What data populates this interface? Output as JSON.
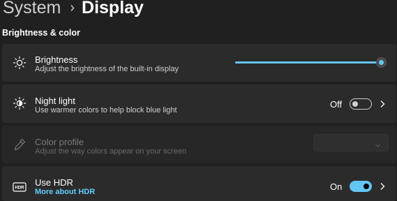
{
  "breadcrumb": {
    "parent": "System",
    "separator": "›",
    "current": "Display"
  },
  "section": {
    "title": "Brightness & color"
  },
  "brightness": {
    "title": "Brightness",
    "description": "Adjust the brightness of the built-in display",
    "level_percent": 100
  },
  "night_light": {
    "title": "Night light",
    "description": "Use warmer colors to help block blue light",
    "state_label": "Off"
  },
  "color_profile": {
    "title": "Color profile",
    "description": "Adjust the way colors appear on your screen",
    "selected": ""
  },
  "hdr": {
    "title": "Use HDR",
    "link": "More about HDR",
    "state_label": "On",
    "icon_text": "HDR"
  },
  "colors": {
    "accent": "#60cdff",
    "background": "#202020",
    "card": "#2b2b2b"
  }
}
